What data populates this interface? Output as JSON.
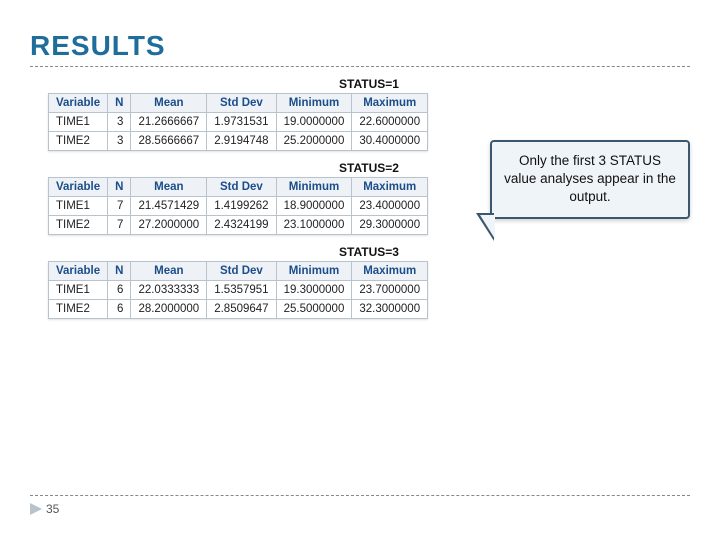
{
  "title": "RESULTS",
  "callout_text": "Only the first 3 STATUS value analyses appear in the output.",
  "columns": [
    "Variable",
    "N",
    "Mean",
    "Std Dev",
    "Minimum",
    "Maximum"
  ],
  "blocks": [
    {
      "heading": "STATUS=1",
      "rows": [
        {
          "var": "TIME1",
          "n": "3",
          "mean": "21.2666667",
          "std": "1.9731531",
          "min": "19.0000000",
          "max": "22.6000000"
        },
        {
          "var": "TIME2",
          "n": "3",
          "mean": "28.5666667",
          "std": "2.9194748",
          "min": "25.2000000",
          "max": "30.4000000"
        }
      ]
    },
    {
      "heading": "STATUS=2",
      "rows": [
        {
          "var": "TIME1",
          "n": "7",
          "mean": "21.4571429",
          "std": "1.4199262",
          "min": "18.9000000",
          "max": "23.4000000"
        },
        {
          "var": "TIME2",
          "n": "7",
          "mean": "27.2000000",
          "std": "2.4324199",
          "min": "23.1000000",
          "max": "29.3000000"
        }
      ]
    },
    {
      "heading": "STATUS=3",
      "rows": [
        {
          "var": "TIME1",
          "n": "6",
          "mean": "22.0333333",
          "std": "1.5357951",
          "min": "19.3000000",
          "max": "23.7000000"
        },
        {
          "var": "TIME2",
          "n": "6",
          "mean": "28.2000000",
          "std": "2.8509647",
          "min": "25.5000000",
          "max": "32.3000000"
        }
      ]
    }
  ],
  "page_number": "35"
}
